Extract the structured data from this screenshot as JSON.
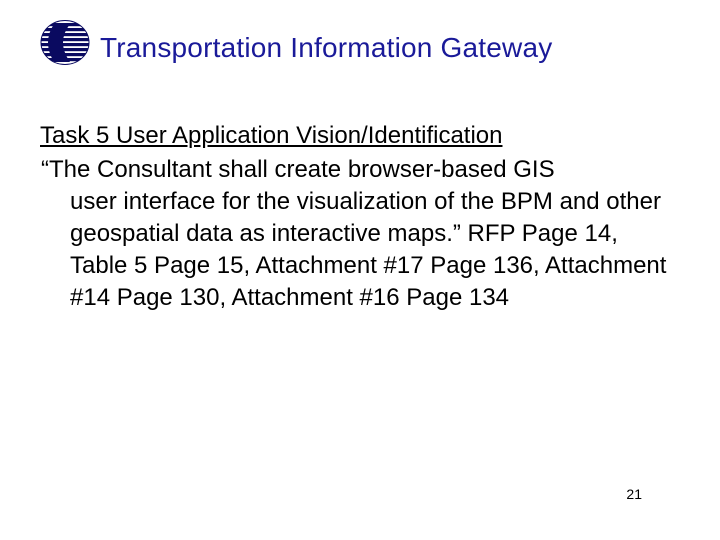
{
  "title": "Transportation Information Gateway",
  "heading": "Task 5 User Application Vision/Identification",
  "paragraph_first": "“The Consultant shall create browser-based GIS",
  "paragraph_rest": "user interface for the visualization of the BPM and other geospatial data as interactive maps.” RFP Page 14, Table 5 Page 15, Attachment #17 Page 136, Attachment #14 Page 130, Attachment #16 Page 134",
  "page_number": "21"
}
